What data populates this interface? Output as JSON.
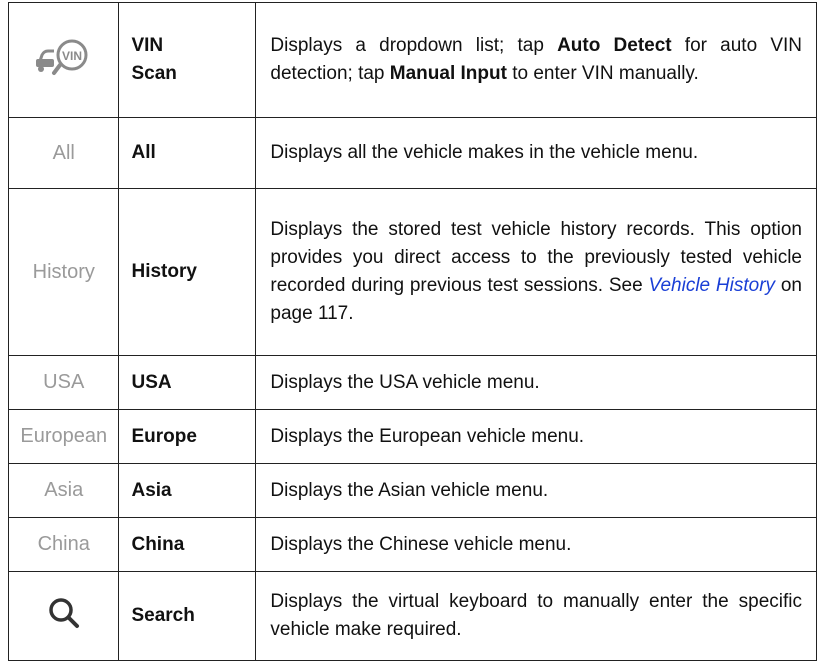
{
  "rows": [
    {
      "icon": "vin-scan-icon",
      "name_line1": "VIN",
      "name_line2": "Scan",
      "desc_part1": "Displays a dropdown list; tap ",
      "desc_bold1": "Auto Detect",
      "desc_part2": " for auto VIN detection; tap ",
      "desc_bold2": "Manual Input",
      "desc_part3": " to enter VIN manually."
    },
    {
      "icon_text": "All",
      "name": "All",
      "desc": "Displays all the vehicle makes in the vehicle menu."
    },
    {
      "icon_text": "History",
      "name": "History",
      "desc_part1": "Displays the stored test vehicle history records. This option provides you direct access to the previously tested vehicle recorded during previous test sessions. See ",
      "desc_link": "Vehicle History",
      "desc_part2": " on page 117."
    },
    {
      "icon_text": "USA",
      "name": "USA",
      "desc": "Displays the USA vehicle menu."
    },
    {
      "icon_text": "European",
      "name": "Europe",
      "desc": "Displays the European vehicle menu."
    },
    {
      "icon_text": "Asia",
      "name": "Asia",
      "desc": "Displays the Asian vehicle menu."
    },
    {
      "icon_text": "China",
      "name": "China",
      "desc": "Displays the Chinese vehicle menu."
    },
    {
      "icon": "search-icon",
      "name": "Search",
      "desc": "Displays the virtual keyboard to manually enter the specific vehicle make required."
    }
  ],
  "colors": {
    "icon_gray": "#9a9a9a",
    "link": "#1a3fd6",
    "border": "#222222"
  }
}
